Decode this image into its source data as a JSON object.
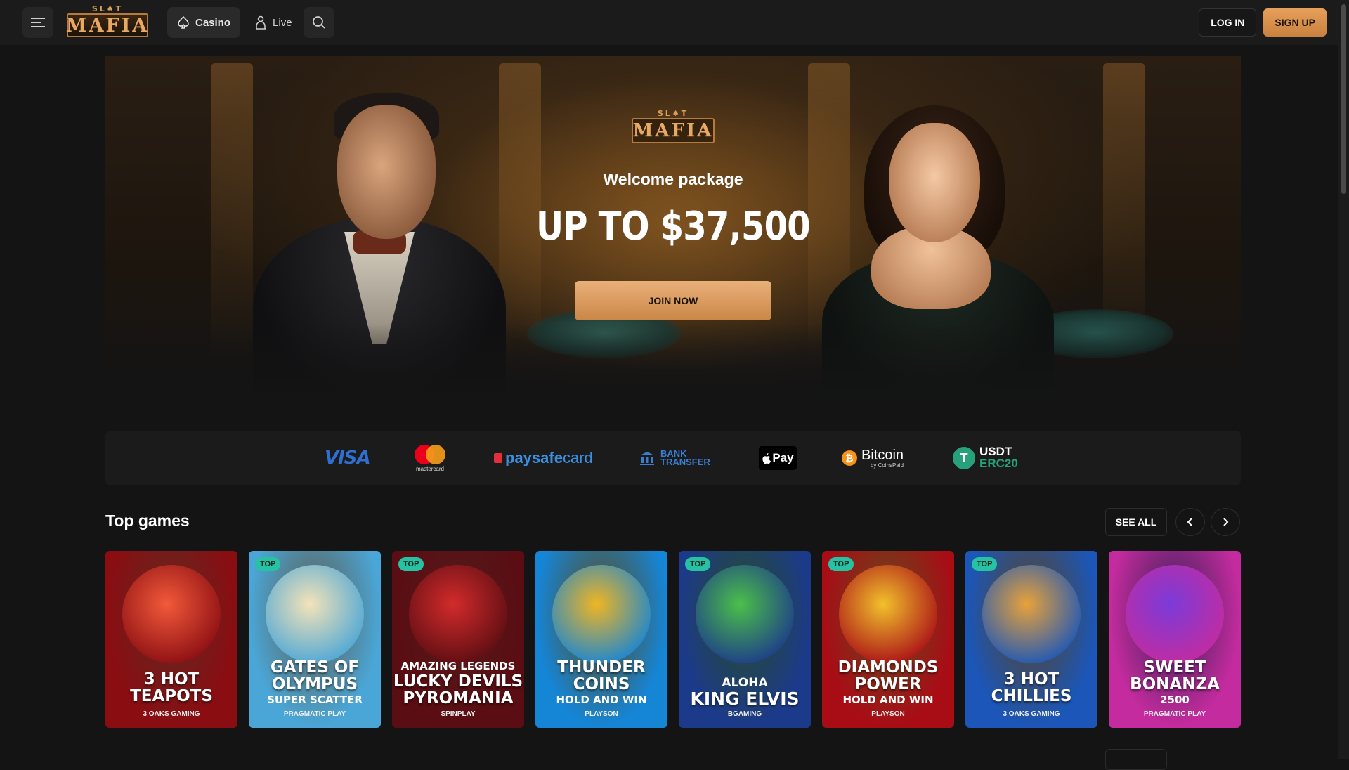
{
  "header": {
    "logo_small": "SL♠T",
    "logo_big": "MAFIA",
    "nav": [
      {
        "label": "Casino",
        "icon": "spade-icon"
      },
      {
        "label": "Live",
        "icon": "dealer-icon"
      }
    ],
    "login_label": "LOG IN",
    "signup_label": "SIGN UP"
  },
  "hero": {
    "logo_small": "SL♠T",
    "logo_big": "MAFIA",
    "subtitle": "Welcome package",
    "amount": "UP TO $37,500",
    "cta": "JOIN NOW"
  },
  "payments": {
    "visa": "VISA",
    "mastercard": "mastercard",
    "paysafe_bold": "paysafe",
    "paysafe_thin": "card",
    "bank_line1": "BANK",
    "bank_line2": "TRANSFER",
    "applepay": "Pay",
    "bitcoin": "Bitcoin",
    "bitcoin_by": "by CoinsPaid",
    "usdt_line1": "USDT",
    "usdt_line2": "ERC20"
  },
  "top_games": {
    "title": "Top games",
    "see_all": "SEE ALL",
    "games": [
      {
        "badge": "",
        "pre": "",
        "title1": "3 HOT",
        "title2": "TEAPOTS",
        "subtitle": "",
        "provider": "3 OAKS GAMING",
        "bg": "#8a0d12",
        "art": "#f25a3a"
      },
      {
        "badge": "TOP",
        "pre": "",
        "title1": "GATES OF",
        "title2": "OLYMPUS",
        "subtitle": "SUPER SCATTER",
        "provider": "PRAGMATIC PLAY",
        "bg": "#4aa6d6",
        "art": "#f4e3b8"
      },
      {
        "badge": "TOP",
        "pre": "AMAZING LEGENDS",
        "title1": "LUCKY DEVILS",
        "title2": "PYROMANIA",
        "subtitle": "",
        "provider": "SPINPLAY",
        "bg": "#5a0d12",
        "art": "#d22b2b"
      },
      {
        "badge": "",
        "pre": "",
        "title1": "THUNDER",
        "title2": "COINS",
        "subtitle": "HOLD AND WIN",
        "provider": "PLAYSON",
        "bg": "#1585d6",
        "art": "#f0b522"
      },
      {
        "badge": "TOP",
        "pre": "ALOHA",
        "title1": "KING ELVIS",
        "title2": "",
        "subtitle": "",
        "provider": "BGAMING",
        "bg": "#1c3a8a",
        "art": "#4bbf4a"
      },
      {
        "badge": "TOP",
        "pre": "",
        "title1": "DIAMONDS",
        "title2": "POWER",
        "subtitle": "HOLD AND WIN",
        "provider": "PLAYSON",
        "bg": "#a80d16",
        "art": "#f2c12c"
      },
      {
        "badge": "TOP",
        "pre": "",
        "title1": "3 HOT",
        "title2": "CHILLIES",
        "subtitle": "",
        "provider": "3 OAKS GAMING",
        "bg": "#1b56b8",
        "art": "#e8a23a"
      },
      {
        "badge": "",
        "pre": "",
        "title1": "SWEET",
        "title2": "BONANZA",
        "subtitle": "2500",
        "provider": "PRAGMATIC PLAY",
        "bg": "#c42b9e",
        "art": "#7b3bd9"
      }
    ]
  }
}
